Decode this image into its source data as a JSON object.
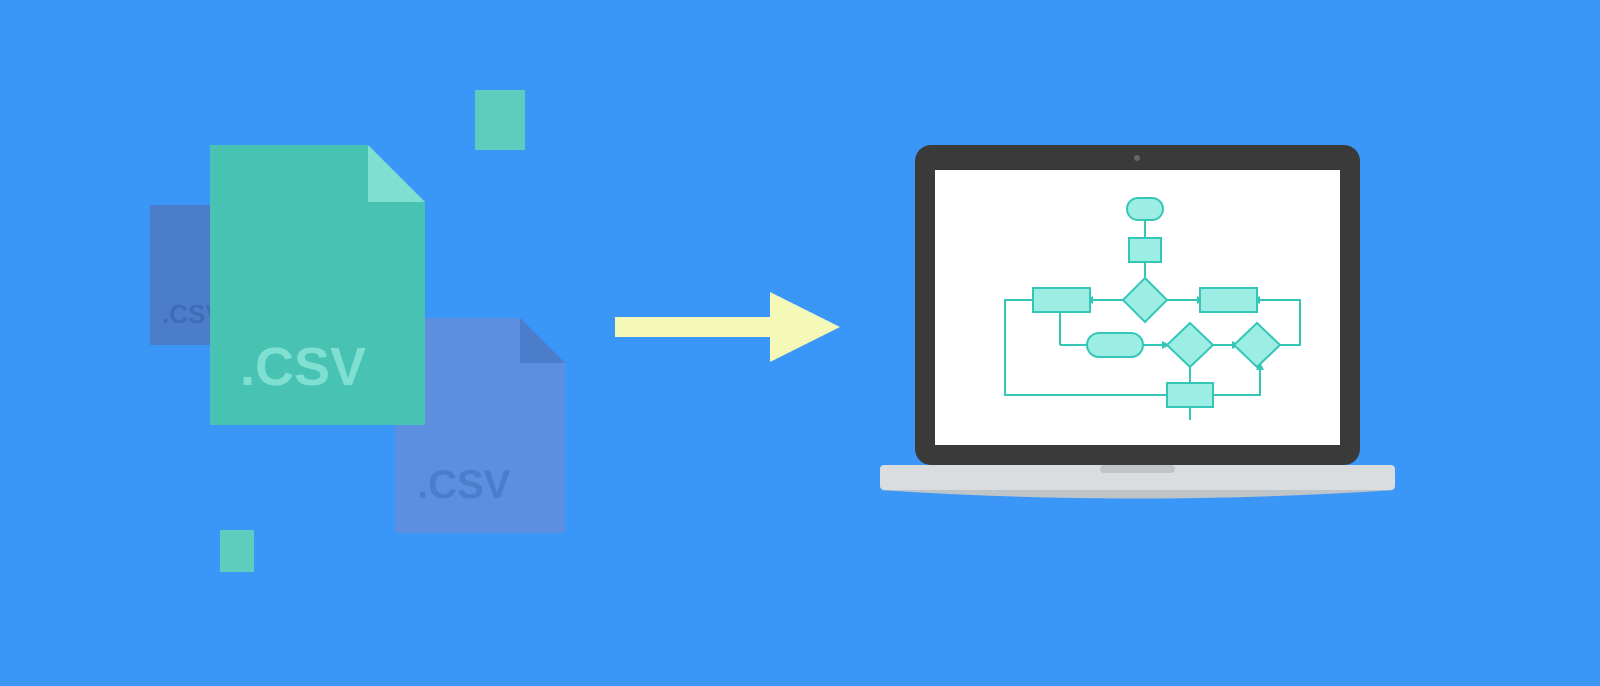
{
  "left_group": {
    "files": [
      {
        "label": ".CSV",
        "color": "#4B7DCB",
        "fold": "#3E6DB5"
      },
      {
        "label": ".CSV",
        "color": "#5C8FDF",
        "fold": "#4B7DCB"
      },
      {
        "label": ".CSV",
        "color": "#56C9BA",
        "fold": "#7FE0D1"
      }
    ],
    "particles": [
      {
        "color": "#5ECDBE"
      },
      {
        "color": "#5ECDBE"
      }
    ]
  },
  "arrow": {
    "color": "#F4F9B8"
  },
  "laptop": {
    "bezel": "#3A3A3A",
    "screen_bg": "#FFFFFF",
    "base": "#D9DDE0",
    "hinge": "#BFC4C8",
    "flowchart": {
      "stroke": "#4ED6C8",
      "fill": "#9CEDE3",
      "shapes": "terminator, process, decision, connectors"
    }
  },
  "background": "#3B97F7"
}
